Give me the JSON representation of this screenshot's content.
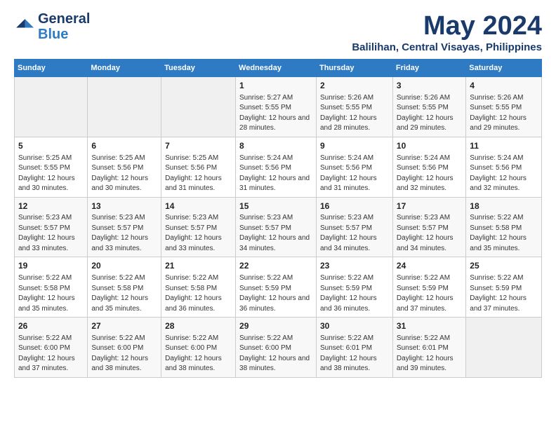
{
  "logo": {
    "line1": "General",
    "line2": "Blue"
  },
  "title": "May 2024",
  "subtitle": "Balilihan, Central Visayas, Philippines",
  "days_of_week": [
    "Sunday",
    "Monday",
    "Tuesday",
    "Wednesday",
    "Thursday",
    "Friday",
    "Saturday"
  ],
  "weeks": [
    [
      {
        "day": "",
        "sunrise": "",
        "sunset": "",
        "daylight": "",
        "empty": true
      },
      {
        "day": "",
        "sunrise": "",
        "sunset": "",
        "daylight": "",
        "empty": true
      },
      {
        "day": "",
        "sunrise": "",
        "sunset": "",
        "daylight": "",
        "empty": true
      },
      {
        "day": "1",
        "sunrise": "Sunrise: 5:27 AM",
        "sunset": "Sunset: 5:55 PM",
        "daylight": "Daylight: 12 hours and 28 minutes.",
        "empty": false
      },
      {
        "day": "2",
        "sunrise": "Sunrise: 5:26 AM",
        "sunset": "Sunset: 5:55 PM",
        "daylight": "Daylight: 12 hours and 28 minutes.",
        "empty": false
      },
      {
        "day": "3",
        "sunrise": "Sunrise: 5:26 AM",
        "sunset": "Sunset: 5:55 PM",
        "daylight": "Daylight: 12 hours and 29 minutes.",
        "empty": false
      },
      {
        "day": "4",
        "sunrise": "Sunrise: 5:26 AM",
        "sunset": "Sunset: 5:55 PM",
        "daylight": "Daylight: 12 hours and 29 minutes.",
        "empty": false
      }
    ],
    [
      {
        "day": "5",
        "sunrise": "Sunrise: 5:25 AM",
        "sunset": "Sunset: 5:55 PM",
        "daylight": "Daylight: 12 hours and 30 minutes.",
        "empty": false
      },
      {
        "day": "6",
        "sunrise": "Sunrise: 5:25 AM",
        "sunset": "Sunset: 5:56 PM",
        "daylight": "Daylight: 12 hours and 30 minutes.",
        "empty": false
      },
      {
        "day": "7",
        "sunrise": "Sunrise: 5:25 AM",
        "sunset": "Sunset: 5:56 PM",
        "daylight": "Daylight: 12 hours and 31 minutes.",
        "empty": false
      },
      {
        "day": "8",
        "sunrise": "Sunrise: 5:24 AM",
        "sunset": "Sunset: 5:56 PM",
        "daylight": "Daylight: 12 hours and 31 minutes.",
        "empty": false
      },
      {
        "day": "9",
        "sunrise": "Sunrise: 5:24 AM",
        "sunset": "Sunset: 5:56 PM",
        "daylight": "Daylight: 12 hours and 31 minutes.",
        "empty": false
      },
      {
        "day": "10",
        "sunrise": "Sunrise: 5:24 AM",
        "sunset": "Sunset: 5:56 PM",
        "daylight": "Daylight: 12 hours and 32 minutes.",
        "empty": false
      },
      {
        "day": "11",
        "sunrise": "Sunrise: 5:24 AM",
        "sunset": "Sunset: 5:56 PM",
        "daylight": "Daylight: 12 hours and 32 minutes.",
        "empty": false
      }
    ],
    [
      {
        "day": "12",
        "sunrise": "Sunrise: 5:23 AM",
        "sunset": "Sunset: 5:57 PM",
        "daylight": "Daylight: 12 hours and 33 minutes.",
        "empty": false
      },
      {
        "day": "13",
        "sunrise": "Sunrise: 5:23 AM",
        "sunset": "Sunset: 5:57 PM",
        "daylight": "Daylight: 12 hours and 33 minutes.",
        "empty": false
      },
      {
        "day": "14",
        "sunrise": "Sunrise: 5:23 AM",
        "sunset": "Sunset: 5:57 PM",
        "daylight": "Daylight: 12 hours and 33 minutes.",
        "empty": false
      },
      {
        "day": "15",
        "sunrise": "Sunrise: 5:23 AM",
        "sunset": "Sunset: 5:57 PM",
        "daylight": "Daylight: 12 hours and 34 minutes.",
        "empty": false
      },
      {
        "day": "16",
        "sunrise": "Sunrise: 5:23 AM",
        "sunset": "Sunset: 5:57 PM",
        "daylight": "Daylight: 12 hours and 34 minutes.",
        "empty": false
      },
      {
        "day": "17",
        "sunrise": "Sunrise: 5:23 AM",
        "sunset": "Sunset: 5:57 PM",
        "daylight": "Daylight: 12 hours and 34 minutes.",
        "empty": false
      },
      {
        "day": "18",
        "sunrise": "Sunrise: 5:22 AM",
        "sunset": "Sunset: 5:58 PM",
        "daylight": "Daylight: 12 hours and 35 minutes.",
        "empty": false
      }
    ],
    [
      {
        "day": "19",
        "sunrise": "Sunrise: 5:22 AM",
        "sunset": "Sunset: 5:58 PM",
        "daylight": "Daylight: 12 hours and 35 minutes.",
        "empty": false
      },
      {
        "day": "20",
        "sunrise": "Sunrise: 5:22 AM",
        "sunset": "Sunset: 5:58 PM",
        "daylight": "Daylight: 12 hours and 35 minutes.",
        "empty": false
      },
      {
        "day": "21",
        "sunrise": "Sunrise: 5:22 AM",
        "sunset": "Sunset: 5:58 PM",
        "daylight": "Daylight: 12 hours and 36 minutes.",
        "empty": false
      },
      {
        "day": "22",
        "sunrise": "Sunrise: 5:22 AM",
        "sunset": "Sunset: 5:59 PM",
        "daylight": "Daylight: 12 hours and 36 minutes.",
        "empty": false
      },
      {
        "day": "23",
        "sunrise": "Sunrise: 5:22 AM",
        "sunset": "Sunset: 5:59 PM",
        "daylight": "Daylight: 12 hours and 36 minutes.",
        "empty": false
      },
      {
        "day": "24",
        "sunrise": "Sunrise: 5:22 AM",
        "sunset": "Sunset: 5:59 PM",
        "daylight": "Daylight: 12 hours and 37 minutes.",
        "empty": false
      },
      {
        "day": "25",
        "sunrise": "Sunrise: 5:22 AM",
        "sunset": "Sunset: 5:59 PM",
        "daylight": "Daylight: 12 hours and 37 minutes.",
        "empty": false
      }
    ],
    [
      {
        "day": "26",
        "sunrise": "Sunrise: 5:22 AM",
        "sunset": "Sunset: 6:00 PM",
        "daylight": "Daylight: 12 hours and 37 minutes.",
        "empty": false
      },
      {
        "day": "27",
        "sunrise": "Sunrise: 5:22 AM",
        "sunset": "Sunset: 6:00 PM",
        "daylight": "Daylight: 12 hours and 38 minutes.",
        "empty": false
      },
      {
        "day": "28",
        "sunrise": "Sunrise: 5:22 AM",
        "sunset": "Sunset: 6:00 PM",
        "daylight": "Daylight: 12 hours and 38 minutes.",
        "empty": false
      },
      {
        "day": "29",
        "sunrise": "Sunrise: 5:22 AM",
        "sunset": "Sunset: 6:00 PM",
        "daylight": "Daylight: 12 hours and 38 minutes.",
        "empty": false
      },
      {
        "day": "30",
        "sunrise": "Sunrise: 5:22 AM",
        "sunset": "Sunset: 6:01 PM",
        "daylight": "Daylight: 12 hours and 38 minutes.",
        "empty": false
      },
      {
        "day": "31",
        "sunrise": "Sunrise: 5:22 AM",
        "sunset": "Sunset: 6:01 PM",
        "daylight": "Daylight: 12 hours and 39 minutes.",
        "empty": false
      },
      {
        "day": "",
        "sunrise": "",
        "sunset": "",
        "daylight": "",
        "empty": true
      }
    ]
  ]
}
